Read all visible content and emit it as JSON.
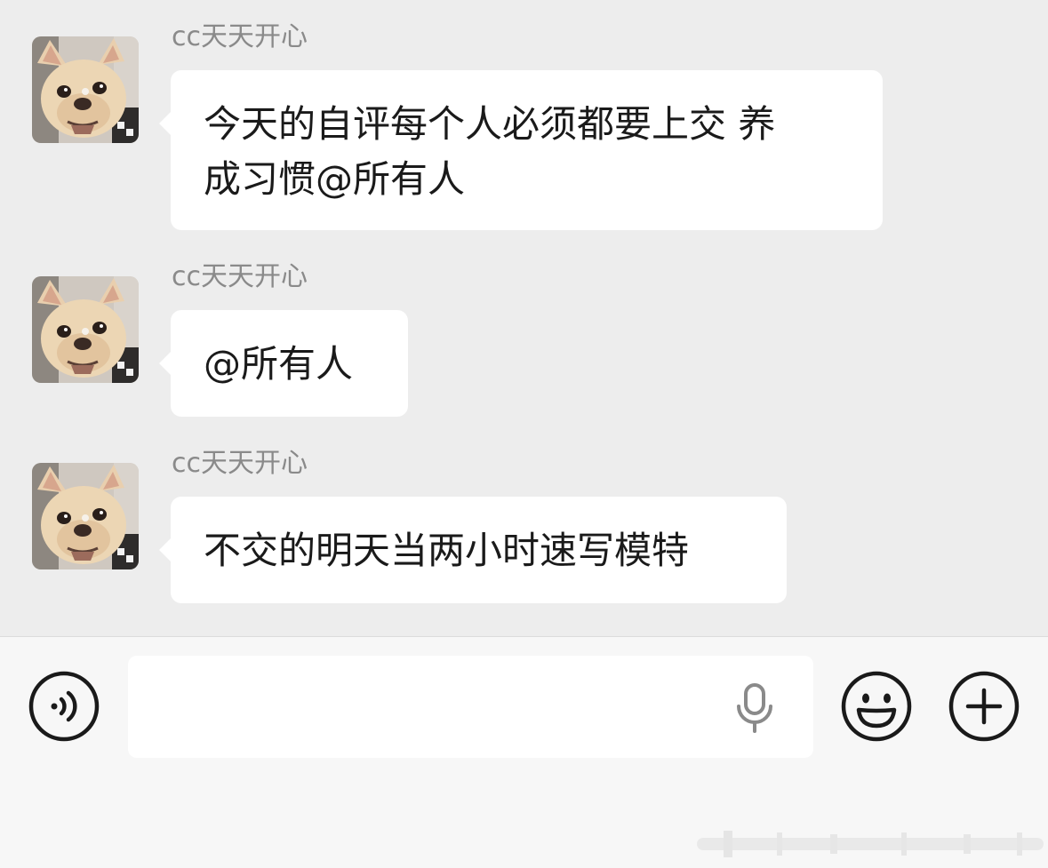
{
  "messages": [
    {
      "sender": "cc天天开心",
      "lines": [
        "今天的自评每个人必须都要上交 养",
        "成习惯@所有人"
      ]
    },
    {
      "sender": "cc天天开心",
      "lines": [
        "@所有人"
      ]
    },
    {
      "sender": "cc天天开心",
      "lines": [
        "不交的明天当两小时速写模特"
      ]
    }
  ],
  "input_bar": {
    "text_value": "",
    "icons": {
      "voice_toggle": "voice-wave-icon",
      "mic": "microphone-icon",
      "emoji": "smiley-face-icon",
      "more": "plus-circle-icon"
    }
  },
  "colors": {
    "chat_background": "#ededed",
    "bubble": "#ffffff",
    "sender_name": "#8a8a8a",
    "message_text": "#1a1a1a",
    "input_bar_background": "#f7f7f7"
  }
}
